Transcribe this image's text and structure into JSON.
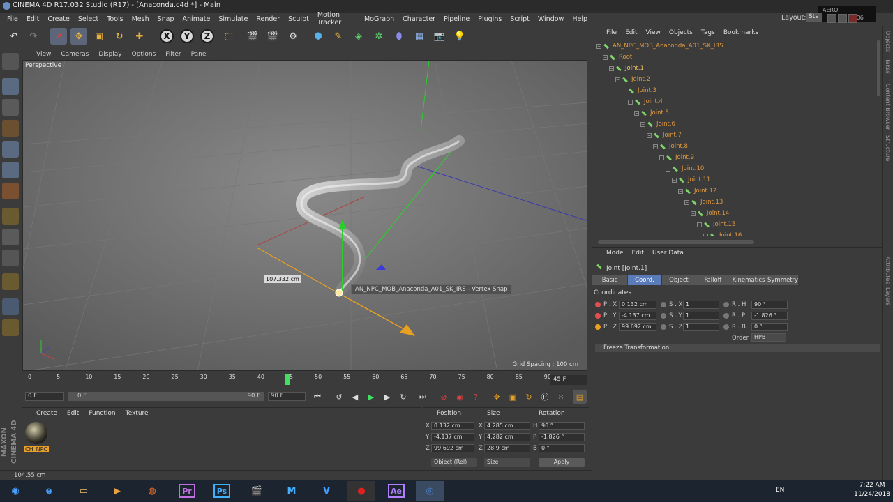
{
  "titlebar": {
    "title": "CINEMA 4D R17.032 Studio (R17) - [Anaconda.c4d *] - Main"
  },
  "menubar": {
    "items": [
      "File",
      "Edit",
      "Create",
      "Select",
      "Tools",
      "Mesh",
      "Snap",
      "Animate",
      "Simulate",
      "Render",
      "Sculpt",
      "Motion Tracker",
      "MoGraph",
      "Character",
      "Pipeline",
      "Plugins",
      "Script",
      "Window",
      "Help"
    ]
  },
  "layout": {
    "label": "Layout:",
    "value": "Sta"
  },
  "overlay_clock": {
    "line1": "AERO",
    "line2": "13",
    "line3": "0:07:06"
  },
  "toolbar": {
    "axis_x": "X",
    "axis_y": "Y",
    "axis_z": "Z"
  },
  "viewport": {
    "menu": [
      "View",
      "Cameras",
      "Display",
      "Options",
      "Filter",
      "Panel"
    ],
    "camera_label": "Perspective",
    "measure": "107.332 cm",
    "snap_label": "AN_NPC_MOB_Anaconda_A01_SK_IRS - Vertex Snap",
    "grid_spacing": "Grid Spacing : 100 cm"
  },
  "timeline": {
    "ticks": [
      "0",
      "5",
      "10",
      "15",
      "20",
      "25",
      "30",
      "35",
      "40",
      "45",
      "50",
      "55",
      "60",
      "65",
      "70",
      "75",
      "80",
      "85",
      "90"
    ],
    "current_frame": "45 F",
    "start_field": "0 F",
    "range_start": "0 F",
    "range_end": "90 F",
    "end_field": "90 F"
  },
  "material_manager": {
    "menu": [
      "Create",
      "Edit",
      "Function",
      "Texture"
    ],
    "material_name": "CH_NPC"
  },
  "maxon_logo": "MAXON CINEMA 4D",
  "coord_manager": {
    "headers": [
      "Position",
      "Size",
      "Rotation"
    ],
    "rows": [
      {
        "axis": "X",
        "pos": "0.132 cm",
        "size_axis": "X",
        "size": "4.285 cm",
        "rot_axis": "H",
        "rot": "90 °"
      },
      {
        "axis": "Y",
        "pos": "-4.137 cm",
        "size_axis": "Y",
        "size": "4.282 cm",
        "rot_axis": "P",
        "rot": "-1.826 °"
      },
      {
        "axis": "Z",
        "pos": "99.692 cm",
        "size_axis": "Z",
        "size": "28.9 cm",
        "rot_axis": "B",
        "rot": "0 °"
      }
    ],
    "mode": "Object (Rel)",
    "size_mode": "Size",
    "apply": "Apply"
  },
  "status": "104.55 cm",
  "object_manager": {
    "menu": [
      "File",
      "Edit",
      "View",
      "Objects",
      "Tags",
      "Bookmarks"
    ],
    "items": [
      {
        "label": "AN_NPC_MOB_Anaconda_A01_SK_IRS",
        "depth": 0
      },
      {
        "label": "Root",
        "depth": 1
      },
      {
        "label": "Joint.1",
        "depth": 2
      },
      {
        "label": "Joint.2",
        "depth": 3
      },
      {
        "label": "Joint.3",
        "depth": 4
      },
      {
        "label": "Joint.4",
        "depth": 5
      },
      {
        "label": "Joint.5",
        "depth": 6
      },
      {
        "label": "Joint.6",
        "depth": 7
      },
      {
        "label": "Joint.7",
        "depth": 8
      },
      {
        "label": "Joint.8",
        "depth": 9
      },
      {
        "label": "Joint.9",
        "depth": 10
      },
      {
        "label": "Joint.10",
        "depth": 11
      },
      {
        "label": "Joint.11",
        "depth": 12
      },
      {
        "label": "Joint.12",
        "depth": 13
      },
      {
        "label": "Joint.13",
        "depth": 14
      },
      {
        "label": "Joint.14",
        "depth": 15
      },
      {
        "label": "Joint.15",
        "depth": 16
      },
      {
        "label": "Joint.16",
        "depth": 17
      }
    ]
  },
  "attributes": {
    "menu": [
      "Mode",
      "Edit",
      "User Data"
    ],
    "title": "Joint [Joint.1]",
    "tabs": [
      "Basic",
      "Coord.",
      "Object",
      "Falloff",
      "Kinematics",
      "Symmetry"
    ],
    "active_tab": "Coord.",
    "section": "Coordinates",
    "rows": [
      {
        "p_label": "P . X",
        "p_val": "0.132 cm",
        "s_label": "S . X",
        "s_val": "1",
        "r_label": "R . H",
        "r_val": "90 °"
      },
      {
        "p_label": "P . Y",
        "p_val": "-4.137 cm",
        "s_label": "S . Y",
        "s_val": "1",
        "r_label": "R . P",
        "r_val": "-1.826 °"
      },
      {
        "p_label": "P . Z",
        "p_val": "99.692 cm",
        "s_label": "S . Z",
        "s_val": "1",
        "r_label": "R . B",
        "r_val": "0 °"
      }
    ],
    "order_label": "Order",
    "order_value": "HPB",
    "freeze": "Freeze Transformation"
  },
  "right_tabs": [
    "Objects",
    "Takes",
    "Content Browser",
    "Structure",
    "Attributes",
    "Layers"
  ],
  "tray": {
    "lang": "EN",
    "time": "7:22 AM",
    "date": "11/24/2018"
  },
  "colors": {
    "accent": "#5a7ab8",
    "object_text": "#e09a40",
    "joint_icon": "#7fd36a",
    "background": "#3b3b3b"
  }
}
